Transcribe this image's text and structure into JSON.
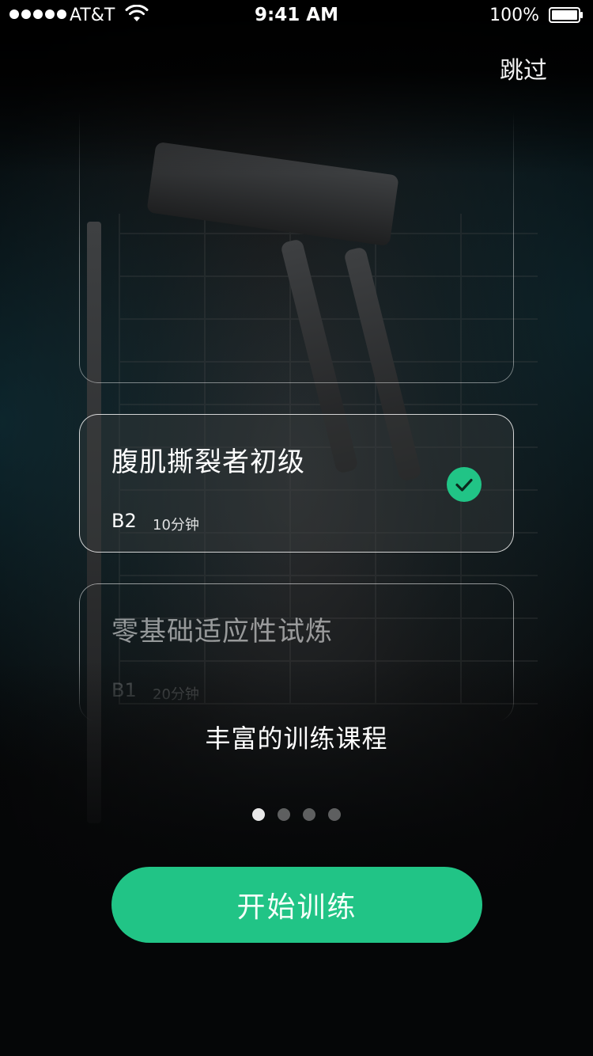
{
  "status_bar": {
    "carrier": "AT&T",
    "time": "9:41 AM",
    "battery": "100%",
    "signal_icon": "signal-dots-icon",
    "wifi_icon": "wifi-icon",
    "battery_icon": "battery-icon"
  },
  "header": {
    "skip_label": "跳过"
  },
  "courses": [
    {
      "title": "腹肌撕裂者初级",
      "level": "B2",
      "duration": "10分钟",
      "selected": true,
      "status_icon": "check-circle-icon"
    },
    {
      "title": "零基础适应性试炼",
      "level": "B1",
      "duration": "20分钟",
      "selected": false
    }
  ],
  "caption": "丰富的训练课程",
  "pager": {
    "count": 4,
    "active_index": 0
  },
  "start_button_label": "开始训练",
  "colors": {
    "accent": "#21C486",
    "background": "#050607"
  }
}
